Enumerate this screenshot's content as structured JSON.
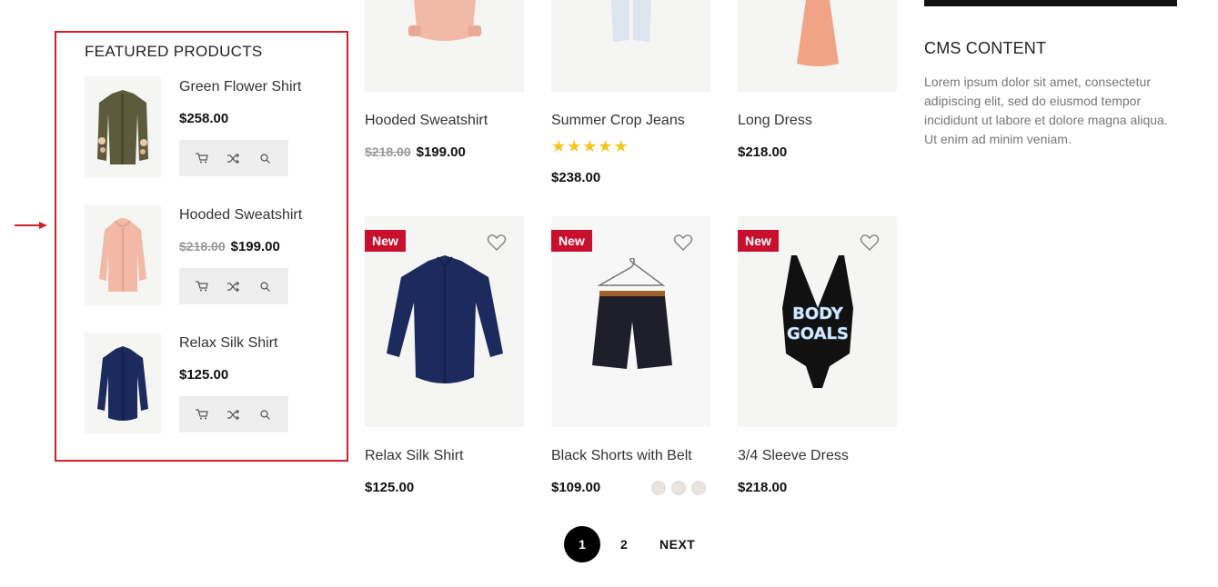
{
  "featured": {
    "title": "FEATURED PRODUCTS",
    "items": [
      {
        "name": "Green Flower Shirt",
        "price": "$258.00",
        "old_price": ""
      },
      {
        "name": "Hooded Sweatshirt",
        "price": "$199.00",
        "old_price": "$218.00"
      },
      {
        "name": "Relax Silk Shirt",
        "price": "$125.00",
        "old_price": ""
      }
    ],
    "action_icons": [
      "cart-icon",
      "shuffle-icon",
      "search-icon"
    ]
  },
  "grid": {
    "row1": [
      {
        "name": "Hooded Sweatshirt",
        "price": "$199.00",
        "old_price": "$218.00"
      },
      {
        "name": "Summer Crop Jeans",
        "price": "$238.00",
        "rating": 5
      },
      {
        "name": "Long Dress",
        "price": "$218.00"
      }
    ],
    "row2": [
      {
        "name": "Relax Silk Shirt",
        "price": "$125.00",
        "badge": "New"
      },
      {
        "name": "Black Shorts with Belt",
        "price": "$109.00",
        "badge": "New"
      },
      {
        "name": "3/4 Sleeve Dress",
        "price": "$218.00",
        "badge": "New",
        "print": "BODY GOALS"
      }
    ]
  },
  "cms": {
    "title": "CMS CONTENT",
    "text": "Lorem ipsum dolor sit amet, consectetur adipiscing elit, sed do eiusmod tempor incididunt ut labore et dolore magna aliqua. Ut enim ad minim veniam."
  },
  "pagination": {
    "current": "1",
    "next_page": "2",
    "next_label": "NEXT"
  },
  "colors": {
    "badge": "#c8102e",
    "annotation": "#d0202a",
    "stars": "#f5c518"
  }
}
